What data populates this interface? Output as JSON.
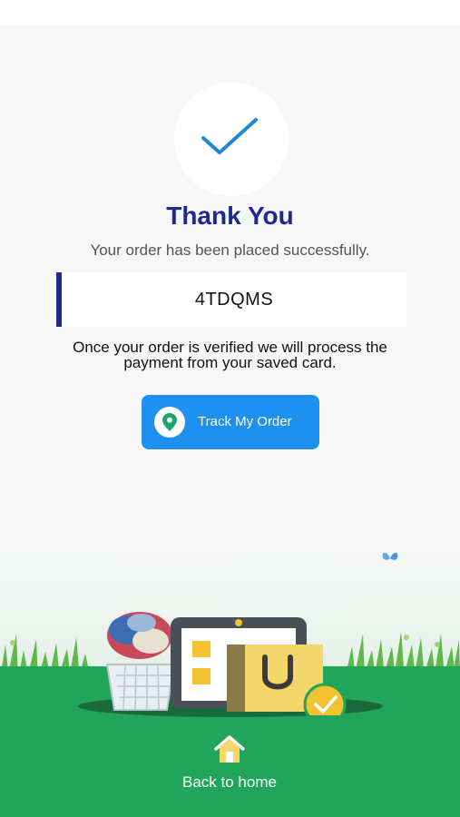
{
  "confirmation": {
    "title": "Thank You",
    "subtitle": "Your order has been placed successfully.",
    "order_id": "4TDQMS",
    "info_line1": "Once your order is verified we will process the",
    "info_line2": "payment from your saved card."
  },
  "actions": {
    "track_order_label": "Track My Order",
    "back_home_label": "Back to home"
  },
  "icons": {
    "check": "check-icon",
    "location_pin": "location-pin-icon",
    "home": "home-icon"
  },
  "colors": {
    "title": "#1f2a8f",
    "primary_button": "#1e90f0",
    "ground": "#21a55a",
    "check": "#1e88d8"
  }
}
